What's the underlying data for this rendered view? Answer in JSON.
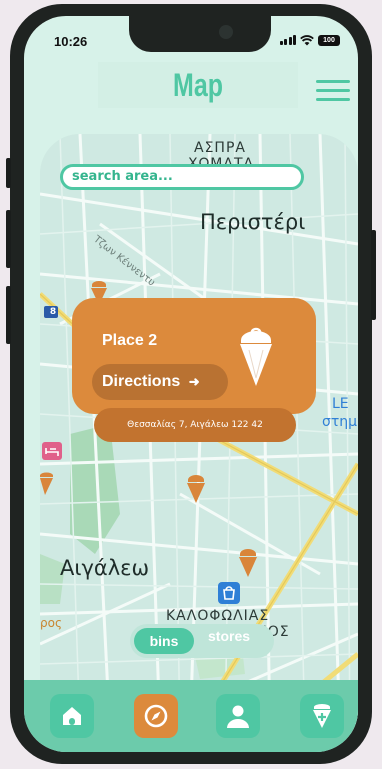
{
  "status_bar": {
    "time": "10:26",
    "battery": "100"
  },
  "header": {
    "title": "Map"
  },
  "search": {
    "placeholder": "search  area..."
  },
  "map_labels": {
    "aspra_1": "ΑΣΠΡΑ",
    "aspra_2": "ΧΩΜΑΤΑ",
    "peristeri": "Περιστέρι",
    "street": "Τζων Κέννεντυ",
    "road_no": "8",
    "aigaleo": "Αιγάλεω",
    "kalofolias_1": "ΚΑΛΟΦΩΛΙΑΣ",
    "kalofolias_2": "ΑΡ. ΔΗΜΗΤΡΙΟΣ",
    "left_edge": "ρος",
    "right_1": "LE",
    "right_2": "στημ"
  },
  "place_card": {
    "title": "Place 2",
    "directions_label": "Directions",
    "directions_arrow": "➜",
    "address": "Θεσσαλίας 7, Αιγάλεω 122 42"
  },
  "toggle": {
    "active": "bins",
    "inactive": "stores"
  },
  "tabs": [
    {
      "name": "home-icon"
    },
    {
      "name": "compass-icon"
    },
    {
      "name": "profile-icon"
    },
    {
      "name": "add-bin-icon"
    }
  ],
  "colors": {
    "accent": "#4fc7a3",
    "card": "#dc8a3c",
    "tabbar": "#6ccbab",
    "map_bg": "#cfe9e2",
    "marker": "#d9853a"
  }
}
